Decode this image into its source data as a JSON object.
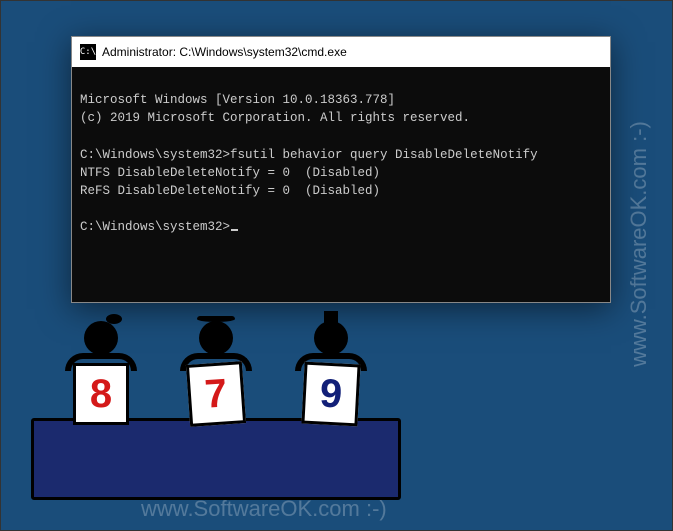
{
  "watermark": "www.SoftwareOK.com :-)",
  "window": {
    "title": "Administrator: C:\\Windows\\system32\\cmd.exe",
    "icon_label": "C:\\"
  },
  "terminal": {
    "line1": "Microsoft Windows [Version 10.0.18363.778]",
    "line2": "(c) 2019 Microsoft Corporation. All rights reserved.",
    "blank1": "",
    "line3": "C:\\Windows\\system32>fsutil behavior query DisableDeleteNotify",
    "line4": "NTFS DisableDeleteNotify = 0  (Disabled)",
    "line5": "ReFS DisableDeleteNotify = 0  (Disabled)",
    "blank2": "",
    "prompt": "C:\\Windows\\system32>"
  },
  "scores": {
    "judge1": "8",
    "judge2": "7",
    "judge3": "9"
  }
}
